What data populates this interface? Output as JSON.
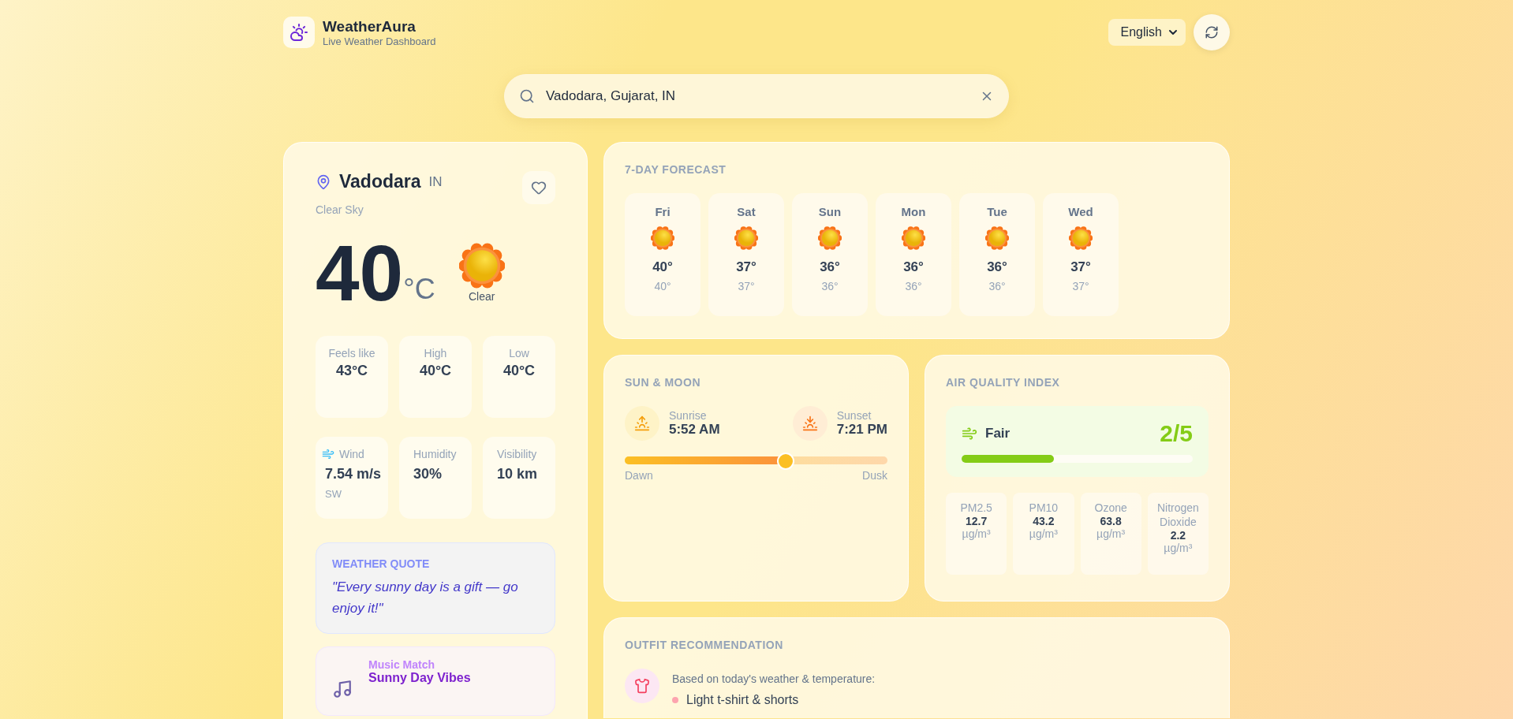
{
  "brand": {
    "name": "WeatherAura",
    "tagline": "Live Weather Dashboard"
  },
  "language": {
    "value": "English"
  },
  "search": {
    "value": "Vadodara, Gujarat, IN"
  },
  "current": {
    "city": "Vadodara",
    "country": "IN",
    "description": "Clear Sky",
    "favorite": false,
    "temp": "40",
    "unit": "°C",
    "condition": "Clear",
    "stats": [
      {
        "label": "Feels like",
        "value": "43°C"
      },
      {
        "label": "High",
        "value": "40°C"
      },
      {
        "label": "Low",
        "value": "40°C"
      }
    ],
    "details": [
      {
        "kind": "wind",
        "label": "Wind",
        "value": "7.54 m/s",
        "sub": "SW"
      },
      {
        "kind": "plain",
        "label": "Humidity",
        "value": "30%"
      },
      {
        "kind": "plain",
        "label": "Visibility",
        "value": "10 km"
      }
    ]
  },
  "quote": {
    "title": "WEATHER QUOTE",
    "text": "\"Every sunny day is a gift — go enjoy it!\""
  },
  "music": {
    "title": "Music Match",
    "track": "Sunny Day Vibes"
  },
  "forecast": {
    "title": "7-DAY FORECAST",
    "days": [
      {
        "day": "Fri",
        "high": "40°",
        "low": "40°"
      },
      {
        "day": "Sat",
        "high": "37°",
        "low": "37°"
      },
      {
        "day": "Sun",
        "high": "36°",
        "low": "36°"
      },
      {
        "day": "Mon",
        "high": "36°",
        "low": "36°"
      },
      {
        "day": "Tue",
        "high": "36°",
        "low": "36°"
      },
      {
        "day": "Wed",
        "high": "37°",
        "low": "37°"
      }
    ]
  },
  "sun": {
    "title": "SUN & MOON",
    "sunrise_label": "Sunrise",
    "sunrise": "5:52 AM",
    "sunset_label": "Sunset",
    "sunset": "7:21 PM",
    "level": 0.61,
    "start": "Dawn",
    "end": "Dusk"
  },
  "aqi": {
    "title": "AIR QUALITY INDEX",
    "label": "Fair",
    "score": "2/5",
    "level": 0.4,
    "color": "#84cc16",
    "pollutants": [
      {
        "name": "PM2.5",
        "value": "12.7",
        "unit": "µg/m³"
      },
      {
        "name": "PM10",
        "value": "43.2",
        "unit": "µg/m³"
      },
      {
        "name": "Ozone",
        "value": "63.8",
        "unit": "µg/m³"
      },
      {
        "name": "Nitrogen Dioxide",
        "value": "2.2",
        "unit": "µg/m³"
      }
    ]
  },
  "outfit": {
    "title": "OUTFIT RECOMMENDATION",
    "intro": "Based on today's weather & temperature:",
    "items": [
      "Light t-shirt & shorts"
    ]
  }
}
